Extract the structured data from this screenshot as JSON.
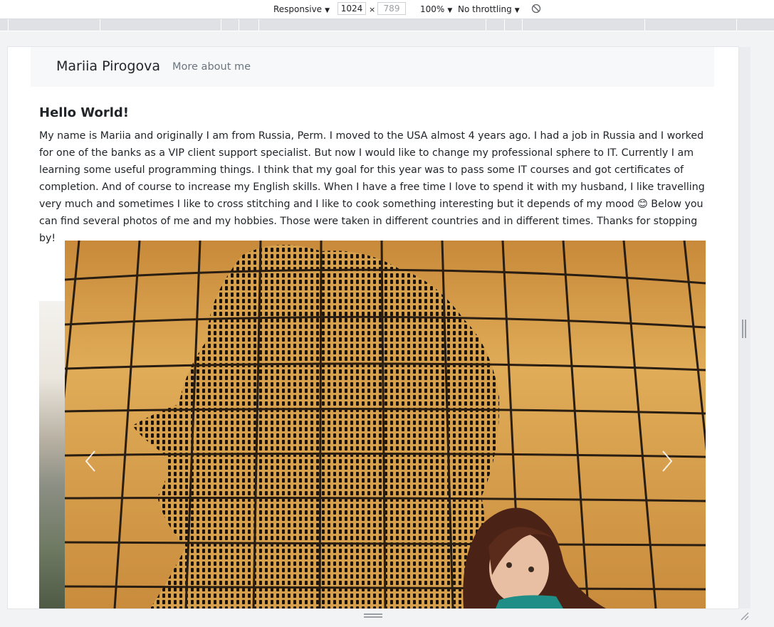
{
  "devtools": {
    "device": "Responsive",
    "width": "1024",
    "height": "789",
    "zoom": "100%",
    "throttling": "No throttling",
    "times": "×",
    "icons": {
      "dropdown": "caret-down-icon",
      "rotate": "rotate-icon"
    }
  },
  "page": {
    "brand": "Mariia Pirogova",
    "nav_link": "More about me",
    "heading": "Hello World!",
    "intro": "My name is Mariia and originally I am from Russia, Perm. I moved to the USA almost 4 years ago. I had a job in Russia and I worked for one of the banks as a VIP client support specialist. But now I would like to change my professional sphere to IT. Currently I am learning some useful programming things. I think that my goal for this year was to pass some IT courses and got certificates of completion. And of course to increase my English skills. When I have a free time I love to spend it with my husband, I like travelling very much and sometimes I like to cross stitching and I like to cook something interesting but it depends of my mood 😊 Below you can find several photos of me and my hobbies. Those were taken in different countries and in different times. Thanks for stopping by!"
  },
  "carousel": {
    "prev_icon": "chevron-left-icon",
    "next_icon": "chevron-right-icon"
  },
  "colors": {
    "navbar_bg": "#f7f8fa",
    "tile_yellow": "#d9a24d",
    "grout_dark": "#2a1e12"
  }
}
